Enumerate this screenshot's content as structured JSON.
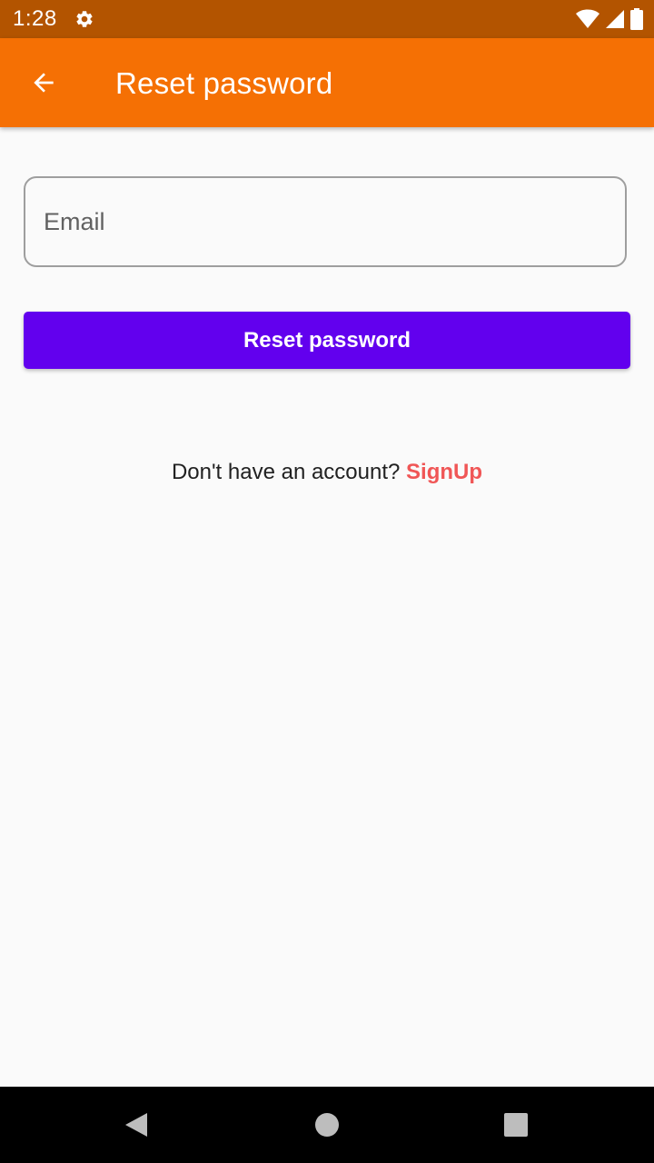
{
  "status_bar": {
    "time": "1:28",
    "icons": [
      "settings-icon",
      "wifi-icon",
      "cell-signal-icon",
      "battery-icon"
    ]
  },
  "app_bar": {
    "title": "Reset password",
    "back_icon": "arrow-back-icon"
  },
  "form": {
    "email_placeholder": "Email",
    "email_value": "",
    "reset_button_label": "Reset password"
  },
  "signup": {
    "prompt": "Don't have an account?",
    "link_label": "SignUp"
  },
  "nav_bar": {
    "icons": [
      "back-triangle-icon",
      "home-circle-icon",
      "recents-square-icon"
    ]
  },
  "colors": {
    "status_bar": "#b35400",
    "app_bar": "#f57004",
    "primary_button": "#6200ee",
    "link": "#f05656",
    "background": "#fafafa"
  }
}
